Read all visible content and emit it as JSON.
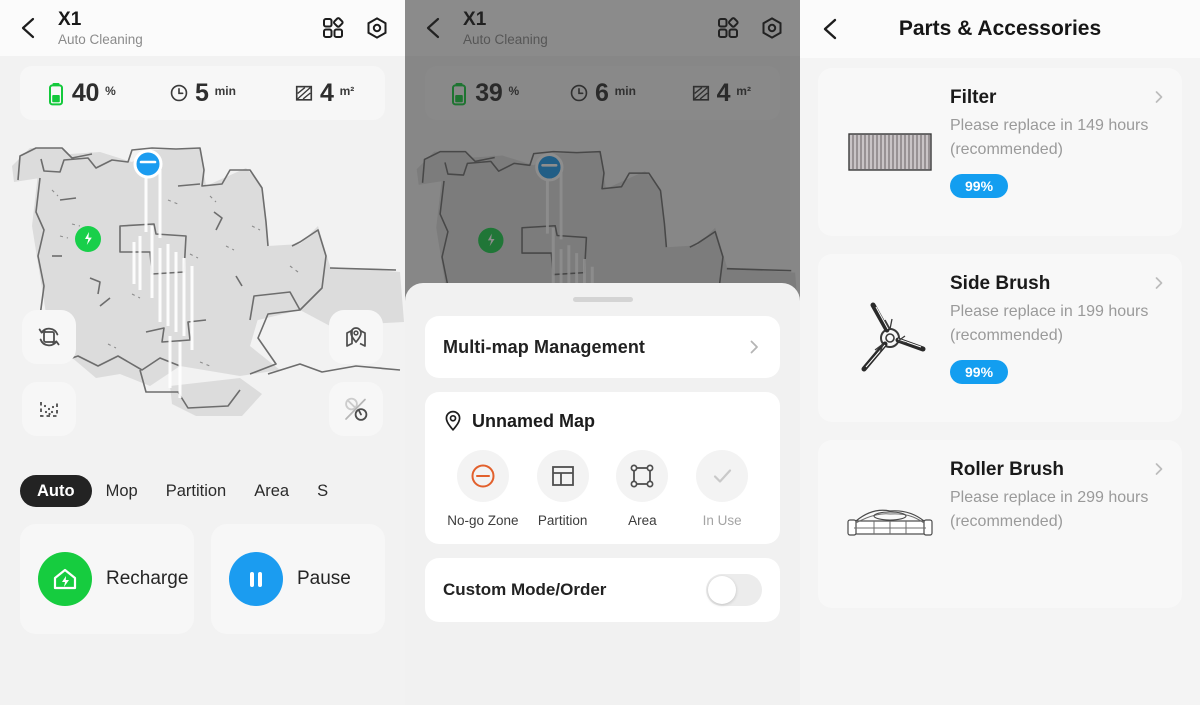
{
  "panel_one": {
    "header": {
      "back_icon": "back-chevron-icon",
      "device_name": "X1",
      "device_status": "Auto Cleaning",
      "grid_icon": "grid-apps-icon",
      "settings_icon": "hexagon-settings-icon"
    },
    "stats": [
      {
        "icon": "battery-icon",
        "value": "40",
        "unit": "%"
      },
      {
        "icon": "clock-icon",
        "value": "5",
        "unit": "min"
      },
      {
        "icon": "area-hatch-icon",
        "value": "4",
        "unit": "m²"
      }
    ],
    "map": {
      "robot_marker": "robot-position-marker",
      "dock_marker": "charging-dock-marker",
      "controls": [
        {
          "name": "relocate-robot-button",
          "icon": "relocate-icon"
        },
        {
          "name": "spot-clean-button",
          "icon": "spot-clean-icon"
        },
        {
          "name": "map-manage-button",
          "icon": "map-pin-icon"
        },
        {
          "name": "no-mop-zone-button",
          "icon": "no-mop-zone-icon"
        }
      ]
    },
    "mode_tabs": [
      {
        "label": "Auto",
        "active": true
      },
      {
        "label": "Mop",
        "active": false
      },
      {
        "label": "Partition",
        "active": false
      },
      {
        "label": "Area",
        "active": false
      },
      {
        "label": "S",
        "active": false
      }
    ],
    "actions": [
      {
        "label": "Recharge",
        "icon": "home-charge-icon",
        "color": "#16cc3f"
      },
      {
        "label": "Pause",
        "icon": "pause-icon",
        "color": "#1b9cf0"
      }
    ]
  },
  "panel_two": {
    "header": {
      "back_icon": "back-chevron-icon",
      "device_name": "X1",
      "device_status": "Auto Cleaning",
      "grid_icon": "grid-apps-icon",
      "settings_icon": "hexagon-settings-icon"
    },
    "stats": [
      {
        "icon": "battery-icon",
        "value": "39",
        "unit": "%"
      },
      {
        "icon": "clock-icon",
        "value": "6",
        "unit": "min"
      },
      {
        "icon": "area-hatch-icon",
        "value": "4",
        "unit": "m²"
      }
    ],
    "sheet": {
      "multi_map_label": "Multi-map Management",
      "chevron_icon": "chevron-right-icon",
      "map_pin_icon": "map-pin-outline-icon",
      "map_name": "Unnamed Map",
      "tools": [
        {
          "label": "No-go Zone",
          "icon": "no-go-zone-icon",
          "muted": false
        },
        {
          "label": "Partition",
          "icon": "partition-icon",
          "muted": false
        },
        {
          "label": "Area",
          "icon": "area-nodes-icon",
          "muted": false
        },
        {
          "label": "In Use",
          "icon": "check-icon",
          "muted": true
        }
      ],
      "custom_mode_label": "Custom Mode/Order",
      "custom_mode_on": false,
      "home_indicator": "home-indicator"
    }
  },
  "panel_three": {
    "header": {
      "back_icon": "back-chevron-icon",
      "title": "Parts & Accessories"
    },
    "parts": [
      {
        "name": "Filter",
        "description": "Please replace in 149 hours (recommended)",
        "badge": "99%",
        "icon": "filter-icon",
        "chevron": "chevron-right-icon"
      },
      {
        "name": "Side Brush",
        "description": "Please replace in 199 hours (recommended)",
        "badge": "99%",
        "icon": "side-brush-icon",
        "chevron": "chevron-right-icon"
      },
      {
        "name": "Roller Brush",
        "description": "Please replace in 299 hours (recommended)",
        "badge": "",
        "icon": "roller-brush-icon",
        "chevron": "chevron-right-icon"
      }
    ]
  },
  "colors": {
    "accent_blue": "#139ef0",
    "accent_green": "#16cc3f",
    "pause_blue": "#1b9cf0",
    "tab_active_bg": "#232323",
    "no_go_orange": "#e2602c",
    "panel_bg": "#f2f2f2",
    "card_bg": "#f7f7f7"
  }
}
